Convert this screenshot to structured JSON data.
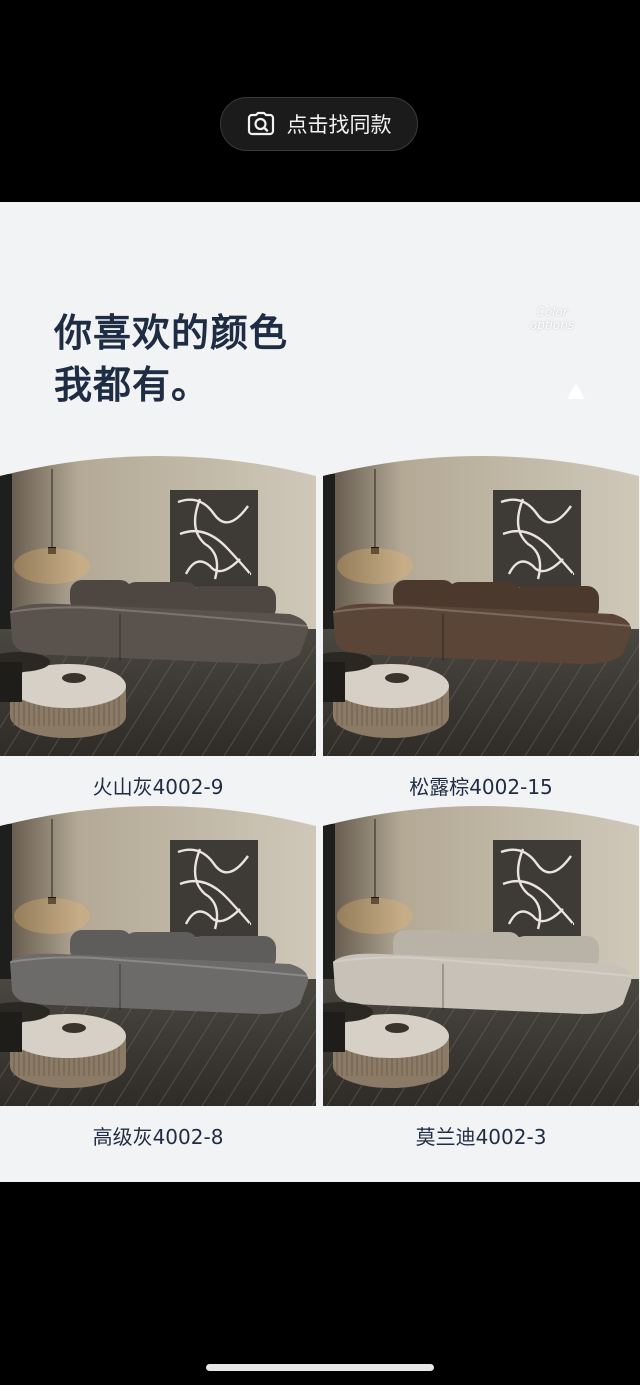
{
  "top_button": {
    "label": "点击找同款",
    "icon": "camera-search-icon"
  },
  "headline": {
    "line1": "你喜欢的颜色",
    "line2": "我都有。"
  },
  "badge": {
    "line1": "Color",
    "line2": "options"
  },
  "products": [
    {
      "name": "火山灰4002-9",
      "sofa_color": "#5a524c",
      "cushion_color": "#4d4641"
    },
    {
      "name": "松露棕4002-15",
      "sofa_color": "#5b4537",
      "cushion_color": "#4c392d"
    },
    {
      "name": "高级灰4002-8",
      "sofa_color": "#6d6b69",
      "cushion_color": "#5f5d5b"
    },
    {
      "name": "莫兰迪4002-3",
      "sofa_color": "#c7c1b7",
      "cushion_color": "#b9b2a7"
    }
  ],
  "colors": {
    "headline": "#1f2d44",
    "content_bg": "#f2f3f5",
    "bars": "#000000"
  }
}
